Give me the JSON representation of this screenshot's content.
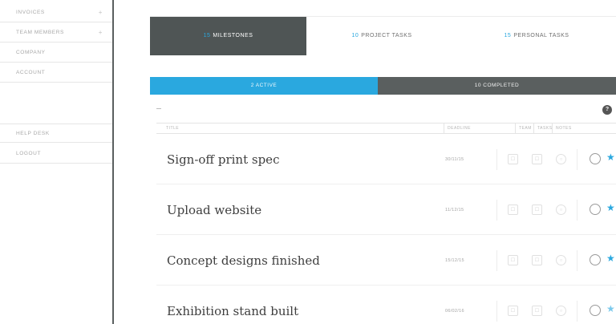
{
  "sidebar": {
    "items": [
      {
        "label": "INVOICES",
        "plus": "+"
      },
      {
        "label": "TEAM MEMBERS",
        "plus": "+"
      },
      {
        "label": "COMPANY",
        "plus": ""
      },
      {
        "label": "ACCOUNT",
        "plus": ""
      }
    ],
    "items2": [
      {
        "label": "HELP DESK"
      },
      {
        "label": "LOGOUT"
      }
    ]
  },
  "tabs": [
    {
      "count": "15",
      "label": "MILESTONES"
    },
    {
      "count": "10",
      "label": "PROJECT TASKS"
    },
    {
      "count": "15",
      "label": "PERSONAL TASKS"
    }
  ],
  "segments": {
    "active": "2 ACTIVE",
    "completed": "10 COMPLETED"
  },
  "help_glyph": "?",
  "columns": {
    "title": "TITLE",
    "deadline": "DEADLINE",
    "team": "TEAM",
    "tasks": "TASKS",
    "notes": "NOTES"
  },
  "rows": [
    {
      "title": "Sign-off print spec",
      "deadline": "30/11/15"
    },
    {
      "title": "Upload website",
      "deadline": "11/12/15"
    },
    {
      "title": "Concept designs finished",
      "deadline": "15/12/15"
    },
    {
      "title": "Exhibition stand built",
      "deadline": "06/02/16"
    }
  ],
  "icons": {
    "star": "★",
    "team": "☐",
    "tasks": "☐",
    "notes": "○"
  },
  "colors": {
    "accent": "#2aa8df",
    "dark": "#4f5555"
  }
}
